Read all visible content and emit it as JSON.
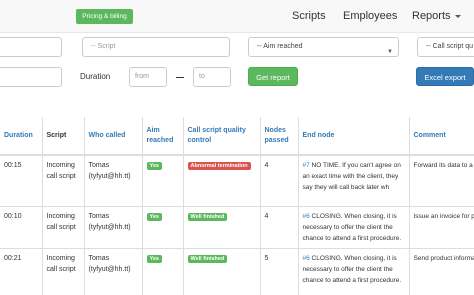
{
  "navbar": {
    "pricing_label": "Pricing & billing",
    "links": [
      "Scripts",
      "Employees",
      "Reports"
    ]
  },
  "filters": {
    "script_placeholder": "-- Script",
    "aim_select": "-- Aim reached",
    "quality_select": "-- Call script qu",
    "duration_label": "Duration",
    "from_placeholder": "from",
    "to_placeholder": "to",
    "get_report": "Get report",
    "excel_export": "Excel export"
  },
  "table": {
    "headers": [
      "Duration",
      "Script",
      "Who called",
      "Aim reached",
      "Call script quality control",
      "Nodes passed",
      "End node",
      "Comment"
    ],
    "rows": [
      {
        "duration": "00:15",
        "script": "Incoming call script",
        "who": "Tomas (tyfyut@hh.tt)",
        "aim": "Yes",
        "quality": "Abnormal termination",
        "nodes": "4",
        "node_id": "#7",
        "end_node": "NO TIME. If you can't agree on an exact time with the client, they say they will call back later wh",
        "comment": "Forward its data to a repair specialist"
      },
      {
        "duration": "00:10",
        "script": "Incoming call script",
        "who": "Tomas (tyfyut@hh.tt)",
        "aim": "Yes",
        "quality": "Well finished",
        "nodes": "4",
        "node_id": "#6",
        "end_node": "CLOSING. When closing, it is necessary to offer the client the chance to attend a first procedure.",
        "comment": "Issue an invoice for payment"
      },
      {
        "duration": "00:21",
        "script": "Incoming call script",
        "who": "Tomas (tyfyut@hh.tt)",
        "aim": "Yes",
        "quality": "Well finished",
        "nodes": "5",
        "node_id": "#6",
        "end_node": "CLOSING. When closing, it is necessary to offer the client the chance to attend a first procedure.",
        "comment": "Send product information to company_email@company"
      }
    ]
  },
  "colors": {
    "primary": "#337ab7",
    "success": "#5cb85c",
    "danger": "#d9534f"
  }
}
